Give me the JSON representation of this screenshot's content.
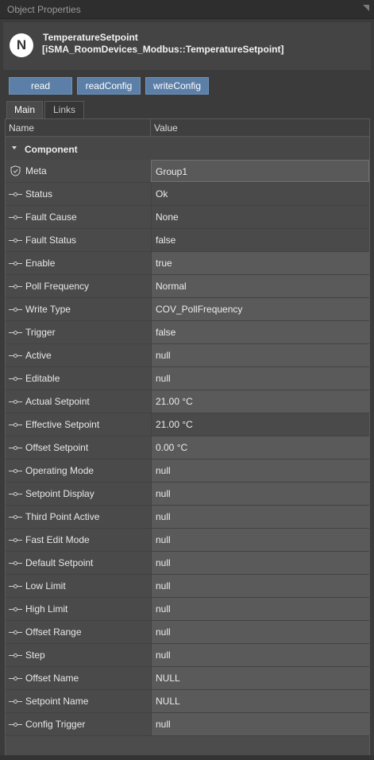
{
  "window": {
    "title": "Object Properties"
  },
  "object": {
    "logo_letter": "N",
    "name": "TemperatureSetpoint",
    "type": "[iSMA_RoomDevices_Modbus::TemperatureSetpoint]"
  },
  "actions": [
    {
      "label": "read"
    },
    {
      "label": "readConfig"
    },
    {
      "label": "writeConfig"
    }
  ],
  "tabs": [
    {
      "label": "Main",
      "active": true
    },
    {
      "label": "Links",
      "active": false
    }
  ],
  "grid": {
    "columns": [
      "Name",
      "Value"
    ],
    "group": "Component",
    "rows": [
      {
        "name": "Meta",
        "value": "Group1",
        "icon": "shield-icon",
        "editable": true
      },
      {
        "name": "Status",
        "value": "Ok",
        "icon": "slot-icon",
        "editable": false
      },
      {
        "name": "Fault Cause",
        "value": "None",
        "icon": "slot-icon",
        "editable": false
      },
      {
        "name": "Fault Status",
        "value": "false",
        "icon": "slot-icon",
        "editable": false
      },
      {
        "name": "Enable",
        "value": "true",
        "icon": "slot-icon",
        "editable": true
      },
      {
        "name": "Poll Frequency",
        "value": "Normal",
        "icon": "slot-icon",
        "editable": true
      },
      {
        "name": "Write Type",
        "value": "COV_PollFrequency",
        "icon": "slot-icon",
        "editable": true
      },
      {
        "name": "Trigger",
        "value": "false",
        "icon": "slot-icon",
        "editable": true
      },
      {
        "name": "Active",
        "value": "null",
        "icon": "slot-icon",
        "editable": true
      },
      {
        "name": "Editable",
        "value": "null",
        "icon": "slot-icon",
        "editable": true
      },
      {
        "name": "Actual Setpoint",
        "value": "21.00 °C",
        "icon": "slot-icon",
        "editable": true
      },
      {
        "name": "Effective Setpoint",
        "value": "21.00 °C",
        "icon": "slot-icon",
        "editable": false
      },
      {
        "name": "Offset Setpoint",
        "value": "0.00 °C",
        "icon": "slot-icon",
        "editable": true
      },
      {
        "name": "Operating Mode",
        "value": "null",
        "icon": "slot-icon",
        "editable": true
      },
      {
        "name": "Setpoint Display",
        "value": "null",
        "icon": "slot-icon",
        "editable": true
      },
      {
        "name": "Third Point Active",
        "value": "null",
        "icon": "slot-icon",
        "editable": true
      },
      {
        "name": "Fast Edit Mode",
        "value": "null",
        "icon": "slot-icon",
        "editable": true
      },
      {
        "name": "Default Setpoint",
        "value": "null",
        "icon": "slot-icon",
        "editable": true
      },
      {
        "name": "Low Limit",
        "value": "null",
        "icon": "slot-icon",
        "editable": true
      },
      {
        "name": "High Limit",
        "value": "null",
        "icon": "slot-icon",
        "editable": true
      },
      {
        "name": "Offset Range",
        "value": "null",
        "icon": "slot-icon",
        "editable": true
      },
      {
        "name": "Step",
        "value": "null",
        "icon": "slot-icon",
        "editable": true
      },
      {
        "name": "Offset Name",
        "value": "NULL",
        "icon": "slot-icon",
        "editable": true
      },
      {
        "name": "Setpoint Name",
        "value": "NULL",
        "icon": "slot-icon",
        "editable": true
      },
      {
        "name": "Config Trigger",
        "value": "null",
        "icon": "slot-icon",
        "editable": true
      }
    ]
  }
}
